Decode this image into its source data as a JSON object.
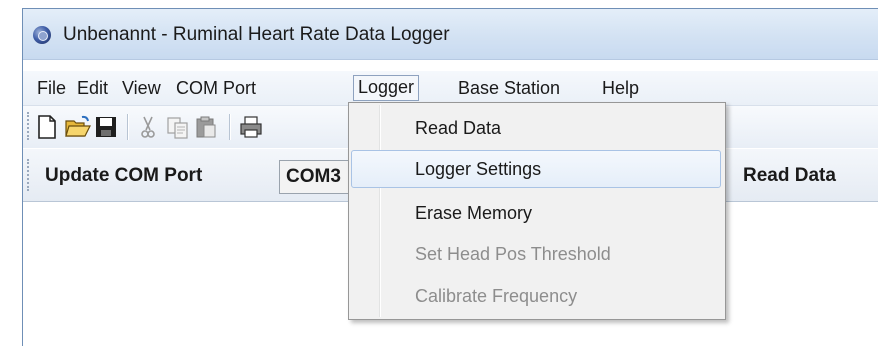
{
  "window": {
    "title": "Unbenannt - Ruminal Heart Rate Data Logger"
  },
  "menubar": {
    "items": [
      {
        "label": "File"
      },
      {
        "label": "Edit"
      },
      {
        "label": "View"
      },
      {
        "label": "COM Port"
      },
      {
        "label": "Logger"
      },
      {
        "label": "Base Station"
      },
      {
        "label": "Help"
      }
    ]
  },
  "toolbar": {
    "icons": [
      "new-file-icon",
      "open-folder-icon",
      "save-icon",
      "cut-icon",
      "copy-icon",
      "paste-icon",
      "print-icon"
    ]
  },
  "controls": {
    "update_com_port_label": "Update COM Port",
    "com_port_value": "COM3",
    "read_data_label": "Read Data"
  },
  "logger_menu": {
    "items": [
      {
        "label": "Read Data",
        "enabled": true
      },
      {
        "label": "Logger Settings",
        "enabled": true
      },
      {
        "label": "Erase Memory",
        "enabled": true
      },
      {
        "label": "Set Head Pos Threshold",
        "enabled": false
      },
      {
        "label": "Calibrate Frequency",
        "enabled": false
      }
    ]
  }
}
